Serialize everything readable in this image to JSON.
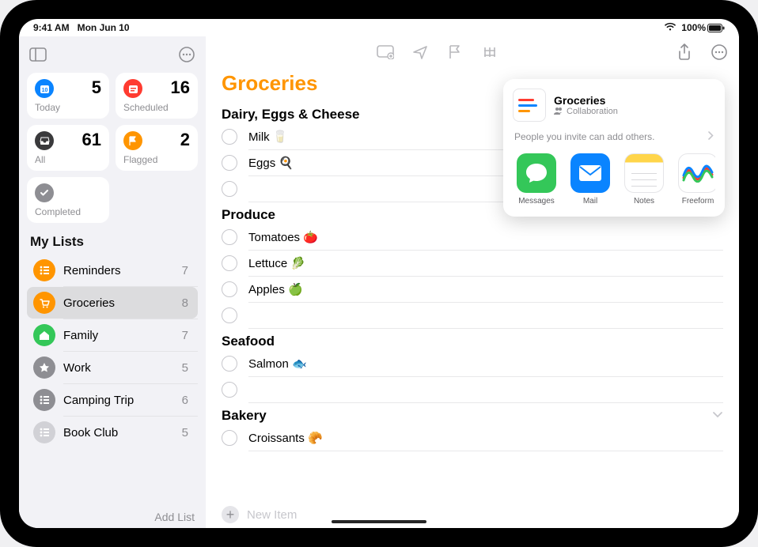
{
  "status": {
    "time": "9:41 AM",
    "date": "Mon Jun 10",
    "battery": "100%"
  },
  "sidebar": {
    "smart": {
      "today": {
        "label": "Today",
        "count": "5",
        "color": "#0a84ff"
      },
      "scheduled": {
        "label": "Scheduled",
        "count": "16",
        "color": "#ff3b30"
      },
      "all": {
        "label": "All",
        "count": "61",
        "color": "#1c1c1e"
      },
      "flagged": {
        "label": "Flagged",
        "count": "2",
        "color": "#ff9500"
      },
      "completed": {
        "label": "Completed",
        "color": "#8e8e93"
      }
    },
    "my_lists_title": "My Lists",
    "lists": [
      {
        "name": "Reminders",
        "count": "7",
        "color": "#ff9500",
        "selected": false
      },
      {
        "name": "Groceries",
        "count": "8",
        "color": "#ff9500",
        "selected": true
      },
      {
        "name": "Family",
        "count": "7",
        "color": "#34c759",
        "selected": false
      },
      {
        "name": "Work",
        "count": "5",
        "color": "#8e8e93",
        "selected": false
      },
      {
        "name": "Camping Trip",
        "count": "6",
        "color": "#8e8e93",
        "selected": false
      },
      {
        "name": "Book Club",
        "count": "5",
        "color": "#d1d1d6",
        "selected": false
      }
    ],
    "add_list": "Add List"
  },
  "main": {
    "title": "Groceries",
    "sections": [
      {
        "title": "Dairy, Eggs & Cheese",
        "items": [
          "Milk 🥛",
          "Eggs 🍳"
        ],
        "has_empty": true
      },
      {
        "title": "Produce",
        "items": [
          "Tomatoes 🍅",
          "Lettuce 🥬",
          "Apples 🍏"
        ],
        "has_empty": true
      },
      {
        "title": "Seafood",
        "items": [
          "Salmon 🐟"
        ],
        "has_empty": true
      },
      {
        "title": "Bakery",
        "items": [
          "Croissants 🥐"
        ],
        "collapsible": true
      }
    ],
    "new_item": "New Item"
  },
  "share": {
    "title": "Groceries",
    "subtitle": "Collaboration",
    "invite_text": "People you invite can add others.",
    "apps": [
      {
        "name": "Messages",
        "bg": "#34c759"
      },
      {
        "name": "Mail",
        "bg": "#0a84ff"
      },
      {
        "name": "Notes",
        "bg": "#ffffff"
      },
      {
        "name": "Freeform",
        "bg": "#ffffff"
      }
    ]
  }
}
